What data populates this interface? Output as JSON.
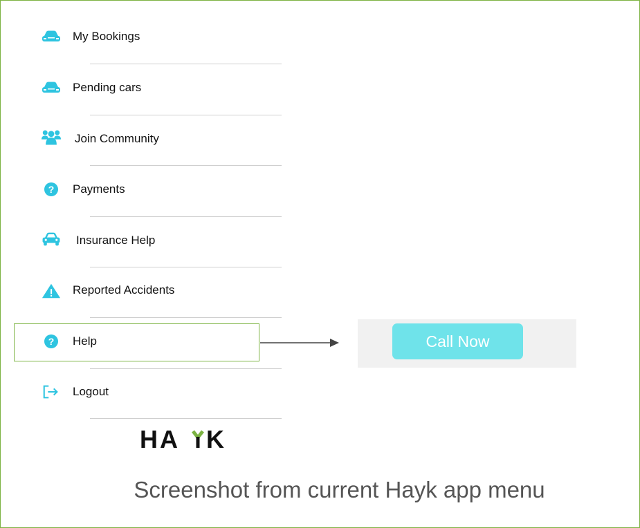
{
  "menu": {
    "items": [
      {
        "label": "My Bookings",
        "icon": "car-icon"
      },
      {
        "label": "Pending cars",
        "icon": "car-icon"
      },
      {
        "label": "Join Community",
        "icon": "people-icon"
      },
      {
        "label": "Payments",
        "icon": "question-circle-icon"
      },
      {
        "label": "Insurance Help",
        "icon": "car-front-icon"
      },
      {
        "label": "Reported Accidents",
        "icon": "warning-triangle-icon"
      },
      {
        "label": "Help",
        "icon": "question-circle-icon"
      },
      {
        "label": "Logout",
        "icon": "logout-icon"
      }
    ]
  },
  "call_panel": {
    "button_label": "Call Now"
  },
  "logo": {
    "text": "HAYK"
  },
  "caption": "Screenshot from current Hayk app menu",
  "colors": {
    "accent": "#2ec4e0",
    "highlight_border": "#7cb342",
    "button": "#6fe3ea"
  }
}
